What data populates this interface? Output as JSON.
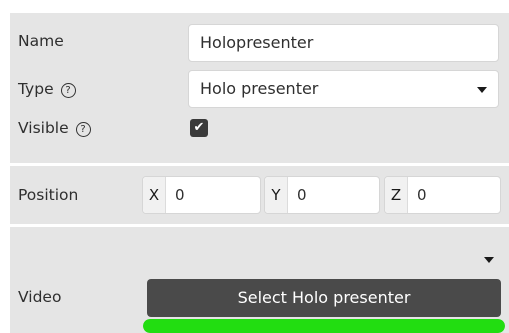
{
  "general": {
    "name_label": "Name",
    "name_value": "Holopresenter",
    "type_label": "Type",
    "type_value": "Holo presenter",
    "visible_label": "Visible",
    "visible_checked": true,
    "help_glyph": "?",
    "checkmark_glyph": "✔"
  },
  "position": {
    "label": "Position",
    "x_label": "X",
    "x_value": "0",
    "y_label": "Y",
    "y_value": "0",
    "z_label": "Z",
    "z_value": "0"
  },
  "video": {
    "label": "Video",
    "select_button_label": "Select Holo presenter",
    "progress_percent": 100,
    "progress_color": "#22dd11"
  },
  "colors": {
    "panel_bg": "#e5e5e5",
    "button_bg": "#4a4a4a",
    "checkbox_bg": "#3a3a3a"
  },
  "icons": {
    "help": "help-circle-icon",
    "dropdown": "chevron-down-icon",
    "check": "checkmark-icon"
  }
}
